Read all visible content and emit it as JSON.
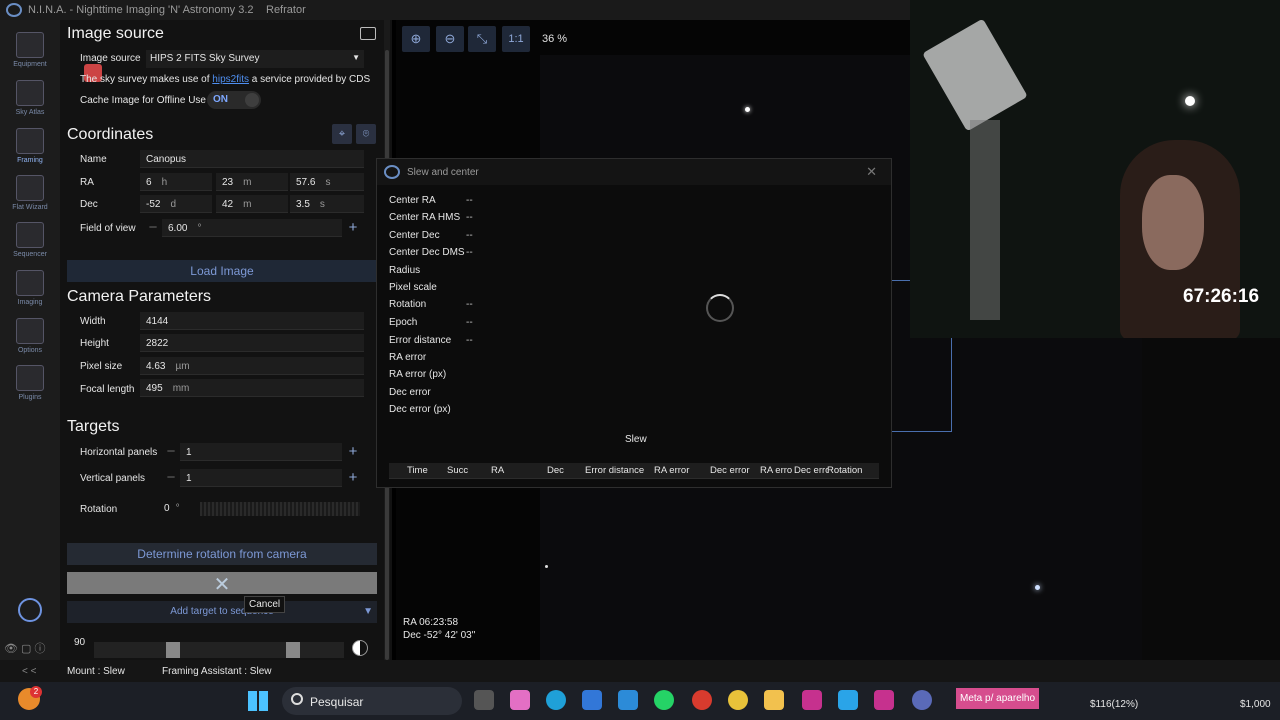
{
  "app": {
    "title": "N.I.N.A. - Nighttime Imaging 'N' Astronomy 3.2",
    "profile": "Refrator"
  },
  "nav": [
    {
      "label": "Equipment"
    },
    {
      "label": "Sky Atlas"
    },
    {
      "label": "Framing"
    },
    {
      "label": "Flat Wizard"
    },
    {
      "label": "Sequencer"
    },
    {
      "label": "Imaging"
    },
    {
      "label": "Options"
    },
    {
      "label": "Plugins"
    }
  ],
  "image_source": {
    "title": "Image source",
    "label": "Image source",
    "value": "HIPS 2 FITS Sky Survey",
    "info_pre": "The sky survey makes use of ",
    "info_link": "hips2fits",
    "info_post": " a service provided by CDS",
    "cache_label": "Cache Image for Offline Use",
    "cache_toggle": "ON"
  },
  "coordinates": {
    "title": "Coordinates",
    "name_label": "Name",
    "name_value": "Canopus",
    "ra_label": "RA",
    "ra_h": "6",
    "ra_h_unit": "h",
    "ra_m": "23",
    "ra_m_unit": "m",
    "ra_s": "57.6",
    "ra_s_unit": "s",
    "dec_label": "Dec",
    "dec_d": "-52",
    "dec_d_unit": "d",
    "dec_m": "42",
    "dec_m_unit": "m",
    "dec_s": "3.5",
    "dec_s_unit": "s",
    "fov_label": "Field of view",
    "fov_value": "6.00",
    "fov_unit": "°"
  },
  "load_image": "Load Image",
  "camera": {
    "title": "Camera Parameters",
    "width_label": "Width",
    "width_value": "4144",
    "height_label": "Height",
    "height_value": "2822",
    "pixel_label": "Pixel size",
    "pixel_value": "4.63",
    "pixel_unit": "µm",
    "focal_label": "Focal length",
    "focal_value": "495",
    "focal_unit": "mm"
  },
  "targets": {
    "title": "Targets",
    "hpanels_label": "Horizontal panels",
    "hpanels_value": "1",
    "vpanels_label": "Vertical panels",
    "vpanels_value": "1",
    "rotation_label": "Rotation",
    "rotation_value": "0",
    "rotation_unit": "°"
  },
  "determine_rotation": "Determine rotation from camera",
  "add_target": "Add target to sequence",
  "cancel_tooltip": "Cancel",
  "opacity_value": "90",
  "viewer": {
    "zoom": "36 %",
    "one_to_one": "1:1",
    "ra_readout": "RA  06:23:58",
    "dec_readout": "Dec  -52° 42' 03\""
  },
  "dialog": {
    "title": "Slew and center",
    "rows": [
      {
        "label": "Center RA",
        "value": "--"
      },
      {
        "label": "Center RA HMS",
        "value": "--"
      },
      {
        "label": "Center Dec",
        "value": "--"
      },
      {
        "label": "Center Dec DMS",
        "value": "--"
      },
      {
        "label": "Radius",
        "value": ""
      },
      {
        "label": "Pixel scale",
        "value": ""
      },
      {
        "label": "Rotation",
        "value": "--"
      },
      {
        "label": "Epoch",
        "value": "--"
      },
      {
        "label": "Error distance",
        "value": "--"
      },
      {
        "label": "RA error",
        "value": ""
      },
      {
        "label": "RA error (px)",
        "value": ""
      },
      {
        "label": "Dec error",
        "value": ""
      },
      {
        "label": "Dec error (px)",
        "value": ""
      }
    ],
    "slew_label": "Slew",
    "columns": [
      "Time",
      "Succ",
      "RA",
      "Dec",
      "Error distance",
      "RA error",
      "Dec error",
      "RA erro",
      "Dec erro",
      "Rotation"
    ]
  },
  "webcam": {
    "timer": "67:26:16"
  },
  "statusbar": {
    "mount": "Mount :  Slew",
    "framing": "Framing Assistant :  Slew",
    "collapse": "< <"
  },
  "taskbar": {
    "search": "Pesquisar",
    "meta": "Meta p/ aparelho",
    "stock": "$116(12%)",
    "amount": "$1,000",
    "badge": "2"
  },
  "colors": {
    "accent": "#7d99d6",
    "toggle_on": "#7da7ff",
    "meta": "#d64d8e"
  }
}
